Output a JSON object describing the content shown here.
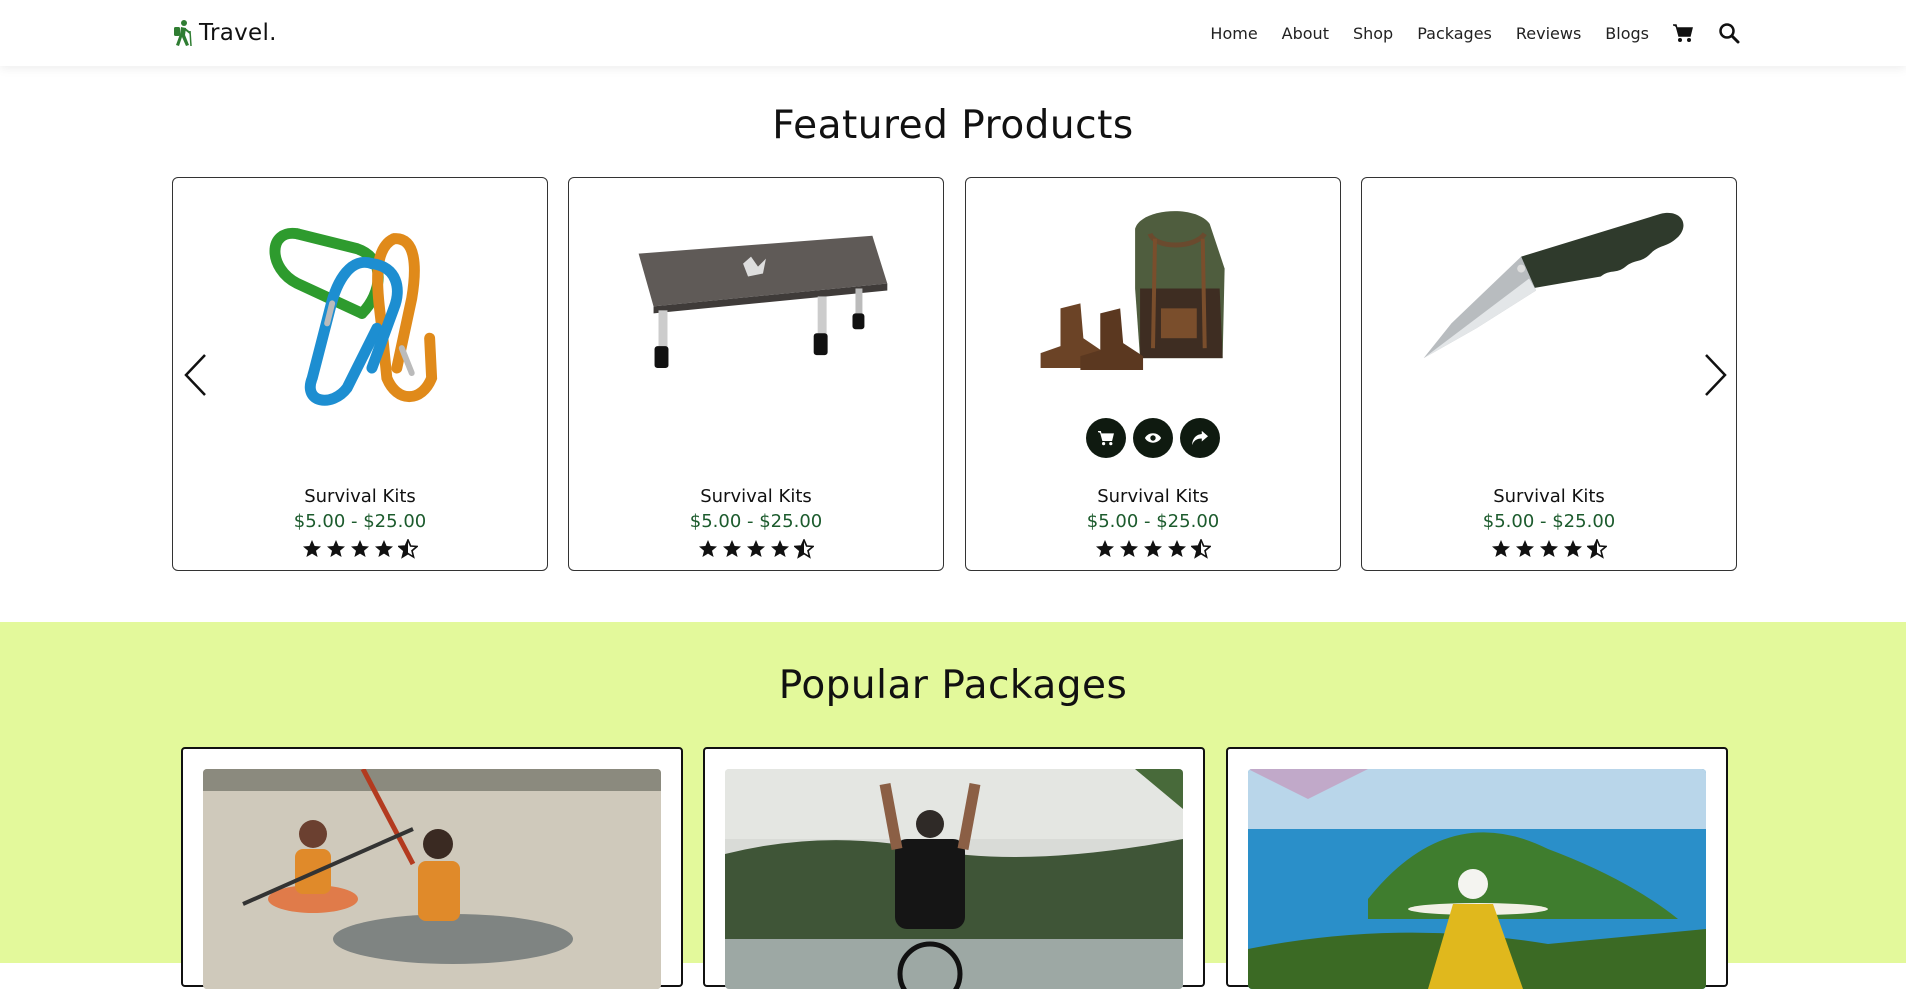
{
  "header": {
    "logo_text": "Travel.",
    "nav": [
      {
        "label": "Home"
      },
      {
        "label": "About"
      },
      {
        "label": "Shop"
      },
      {
        "label": "Packages"
      },
      {
        "label": "Reviews"
      },
      {
        "label": "Blogs"
      }
    ],
    "icons": [
      "cart-icon",
      "search-icon"
    ]
  },
  "featured": {
    "title": "Featured Products",
    "products": [
      {
        "name": "Survival Kits",
        "price": "$5.00 - $25.00",
        "rating": 4.5,
        "image": "carabiners"
      },
      {
        "name": "Survival Kits",
        "price": "$5.00 - $25.00",
        "rating": 4.5,
        "image": "camp-table"
      },
      {
        "name": "Survival Kits",
        "price": "$5.00 - $25.00",
        "rating": 4.5,
        "image": "backpack-boots",
        "actions": [
          "cart-icon",
          "eye-icon",
          "share-icon"
        ]
      },
      {
        "name": "Survival Kits",
        "price": "$5.00 - $25.00",
        "rating": 4.5,
        "image": "pocket-knife"
      }
    ]
  },
  "packages": {
    "title": "Popular Packages",
    "items": [
      {
        "image": "kayaking"
      },
      {
        "image": "cycling"
      },
      {
        "image": "island-view"
      }
    ]
  },
  "colors": {
    "accent_green": "#1c5b2d",
    "packages_bg": "#e3f99b",
    "action_btn": "#0f1a10"
  }
}
